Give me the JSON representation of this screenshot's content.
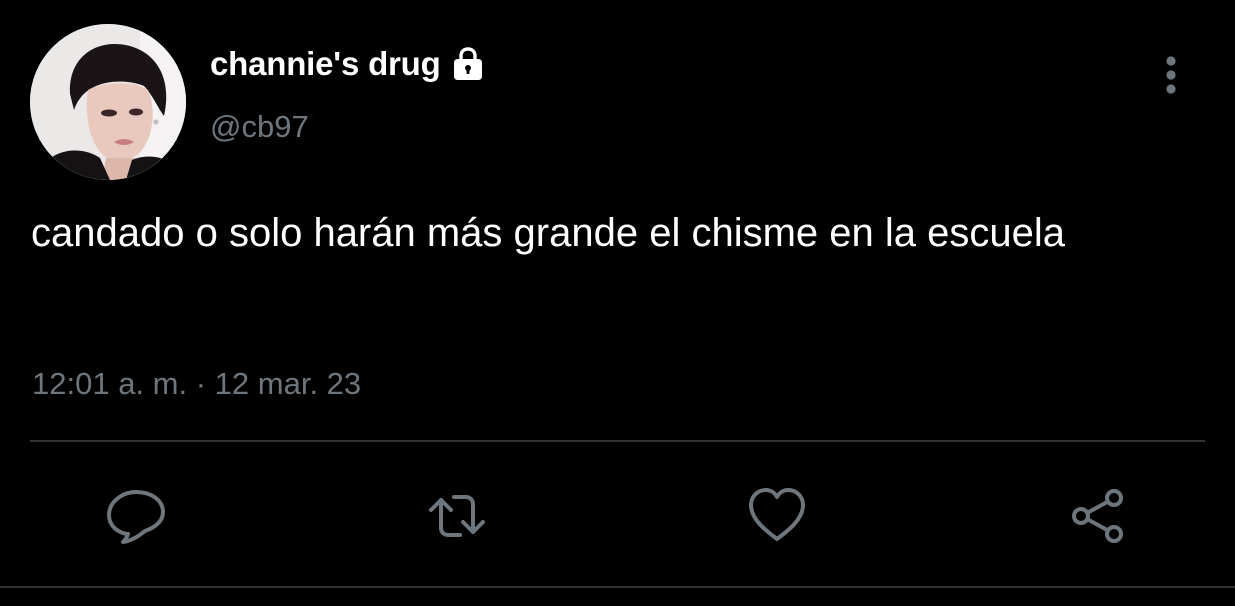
{
  "author": {
    "display_name": "channie's drug",
    "handle": "@cb97",
    "protected": true
  },
  "tweet": {
    "text": "candado o solo harán más grande el chisme en la escuela",
    "time": "12:01 a. m.",
    "separator": "·",
    "date": "12 mar. 23"
  },
  "icons": {
    "lock": "lock-icon",
    "more": "more-vertical-icon",
    "reply": "reply-icon",
    "retweet": "retweet-icon",
    "like": "heart-icon",
    "share": "share-icon"
  },
  "colors": {
    "background": "#000000",
    "primary_text": "#ffffff",
    "secondary_text": "#6e767d",
    "divider": "#2f3336",
    "icon": "#6e767d"
  }
}
